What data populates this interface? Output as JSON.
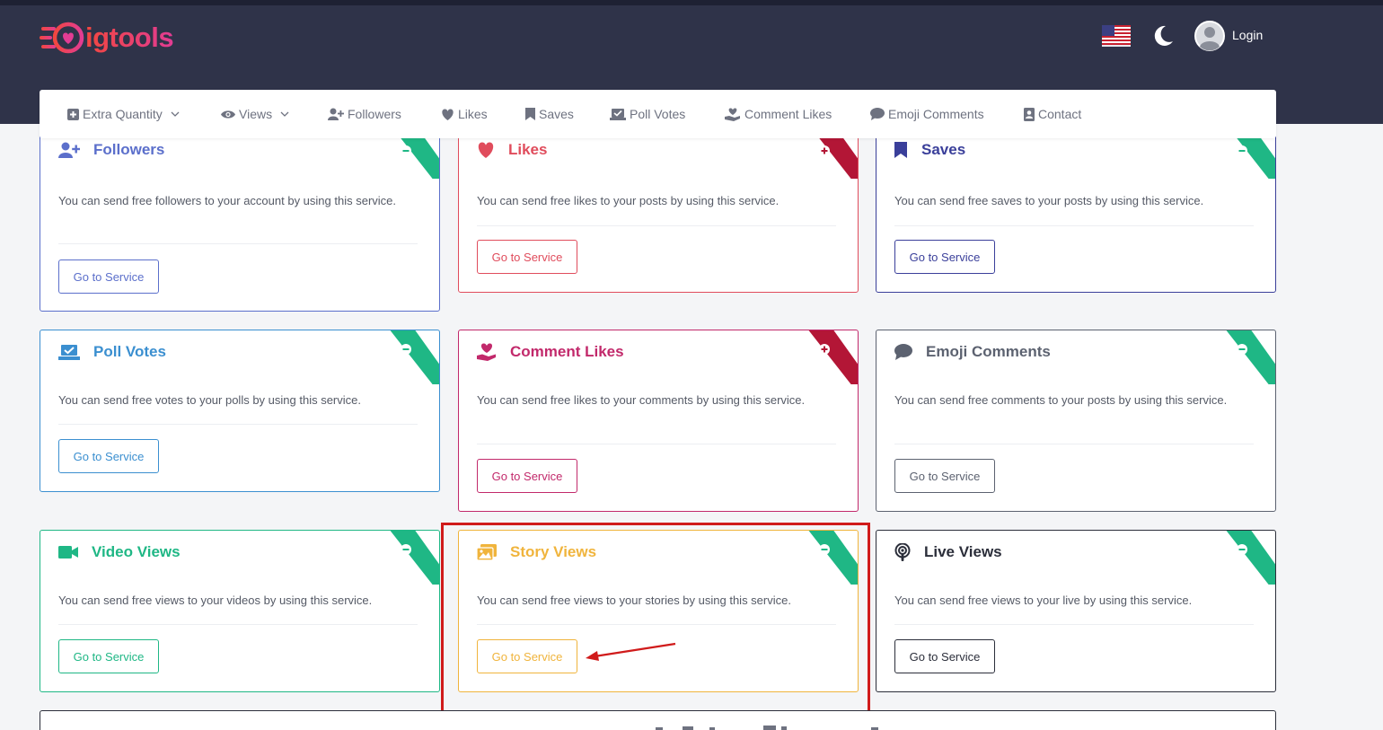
{
  "brand": {
    "logo_text": "igtools",
    "colors": {
      "gradient_start": "#f2473f",
      "gradient_end": "#e23c93"
    }
  },
  "header": {
    "flag_icon": "us-flag-icon",
    "theme_icon": "moon-icon",
    "avatar_icon": "user-avatar-icon",
    "login_label": "Login"
  },
  "nav": {
    "items": [
      {
        "label": "Extra Quantity",
        "icon": "plus-square-icon",
        "dropdown": true
      },
      {
        "label": "Views",
        "icon": "eye-icon",
        "dropdown": true
      },
      {
        "label": "Followers",
        "icon": "user-plus-icon"
      },
      {
        "label": "Likes",
        "icon": "heart-icon"
      },
      {
        "label": "Saves",
        "icon": "bookmark-icon"
      },
      {
        "label": "Poll Votes",
        "icon": "poll-icon"
      },
      {
        "label": "Comment Likes",
        "icon": "hand-heart-icon"
      },
      {
        "label": "Emoji Comments",
        "icon": "comment-icon"
      },
      {
        "label": "Contact",
        "icon": "address-card-icon"
      }
    ]
  },
  "cards": [
    {
      "title": "Followers",
      "description": "You can send free followers to your account by using this service.",
      "button": "Go to Service",
      "color": "#5b6fcb",
      "ribbon": "#1fb785",
      "ribbon_icon": "minus-circle-icon"
    },
    {
      "title": "Likes",
      "description": "You can send free likes to your posts by using this service.",
      "button": "Go to Service",
      "color": "#e04c5c",
      "ribbon": "#b31636",
      "ribbon_icon": "plus-circle-icon"
    },
    {
      "title": "Saves",
      "description": "You can send free saves to your posts by using this service.",
      "button": "Go to Service",
      "color": "#3a3f9a",
      "ribbon": "#1fb785",
      "ribbon_icon": "minus-circle-icon"
    },
    {
      "title": "Poll Votes",
      "description": "You can send free votes to your polls by using this service.",
      "button": "Go to Service",
      "color": "#3b8fd0",
      "ribbon": "#1fb785",
      "ribbon_icon": "minus-circle-icon"
    },
    {
      "title": "Comment Likes",
      "description": "You can send free likes to your comments by using this service.",
      "button": "Go to Service",
      "color": "#c2296b",
      "ribbon": "#b31636",
      "ribbon_icon": "plus-circle-icon"
    },
    {
      "title": "Emoji Comments",
      "description": "You can send free comments to your posts by using this service.",
      "button": "Go to Service",
      "color": "#5c6270",
      "ribbon": "#1fb785",
      "ribbon_icon": "minus-circle-icon"
    },
    {
      "title": "Video Views",
      "description": "You can send free views to your videos by using this service.",
      "button": "Go to Service",
      "color": "#1fb785",
      "ribbon": "#1fb785",
      "ribbon_icon": "minus-circle-icon"
    },
    {
      "title": "Story Views",
      "description": "You can send free views to your stories by using this service.",
      "button": "Go to Service",
      "color": "#f0b43c",
      "ribbon": "#1fb785",
      "ribbon_icon": "minus-circle-icon"
    },
    {
      "title": "Live Views",
      "description": "You can send free views to your live by using this service.",
      "button": "Go to Service",
      "color": "#2b2e3a",
      "ribbon": "#1fb785",
      "ribbon_icon": "minus-circle-icon"
    }
  ],
  "annotation": {
    "highlight_color": "#d01b1b",
    "arrow_color": "#d01b1b"
  }
}
